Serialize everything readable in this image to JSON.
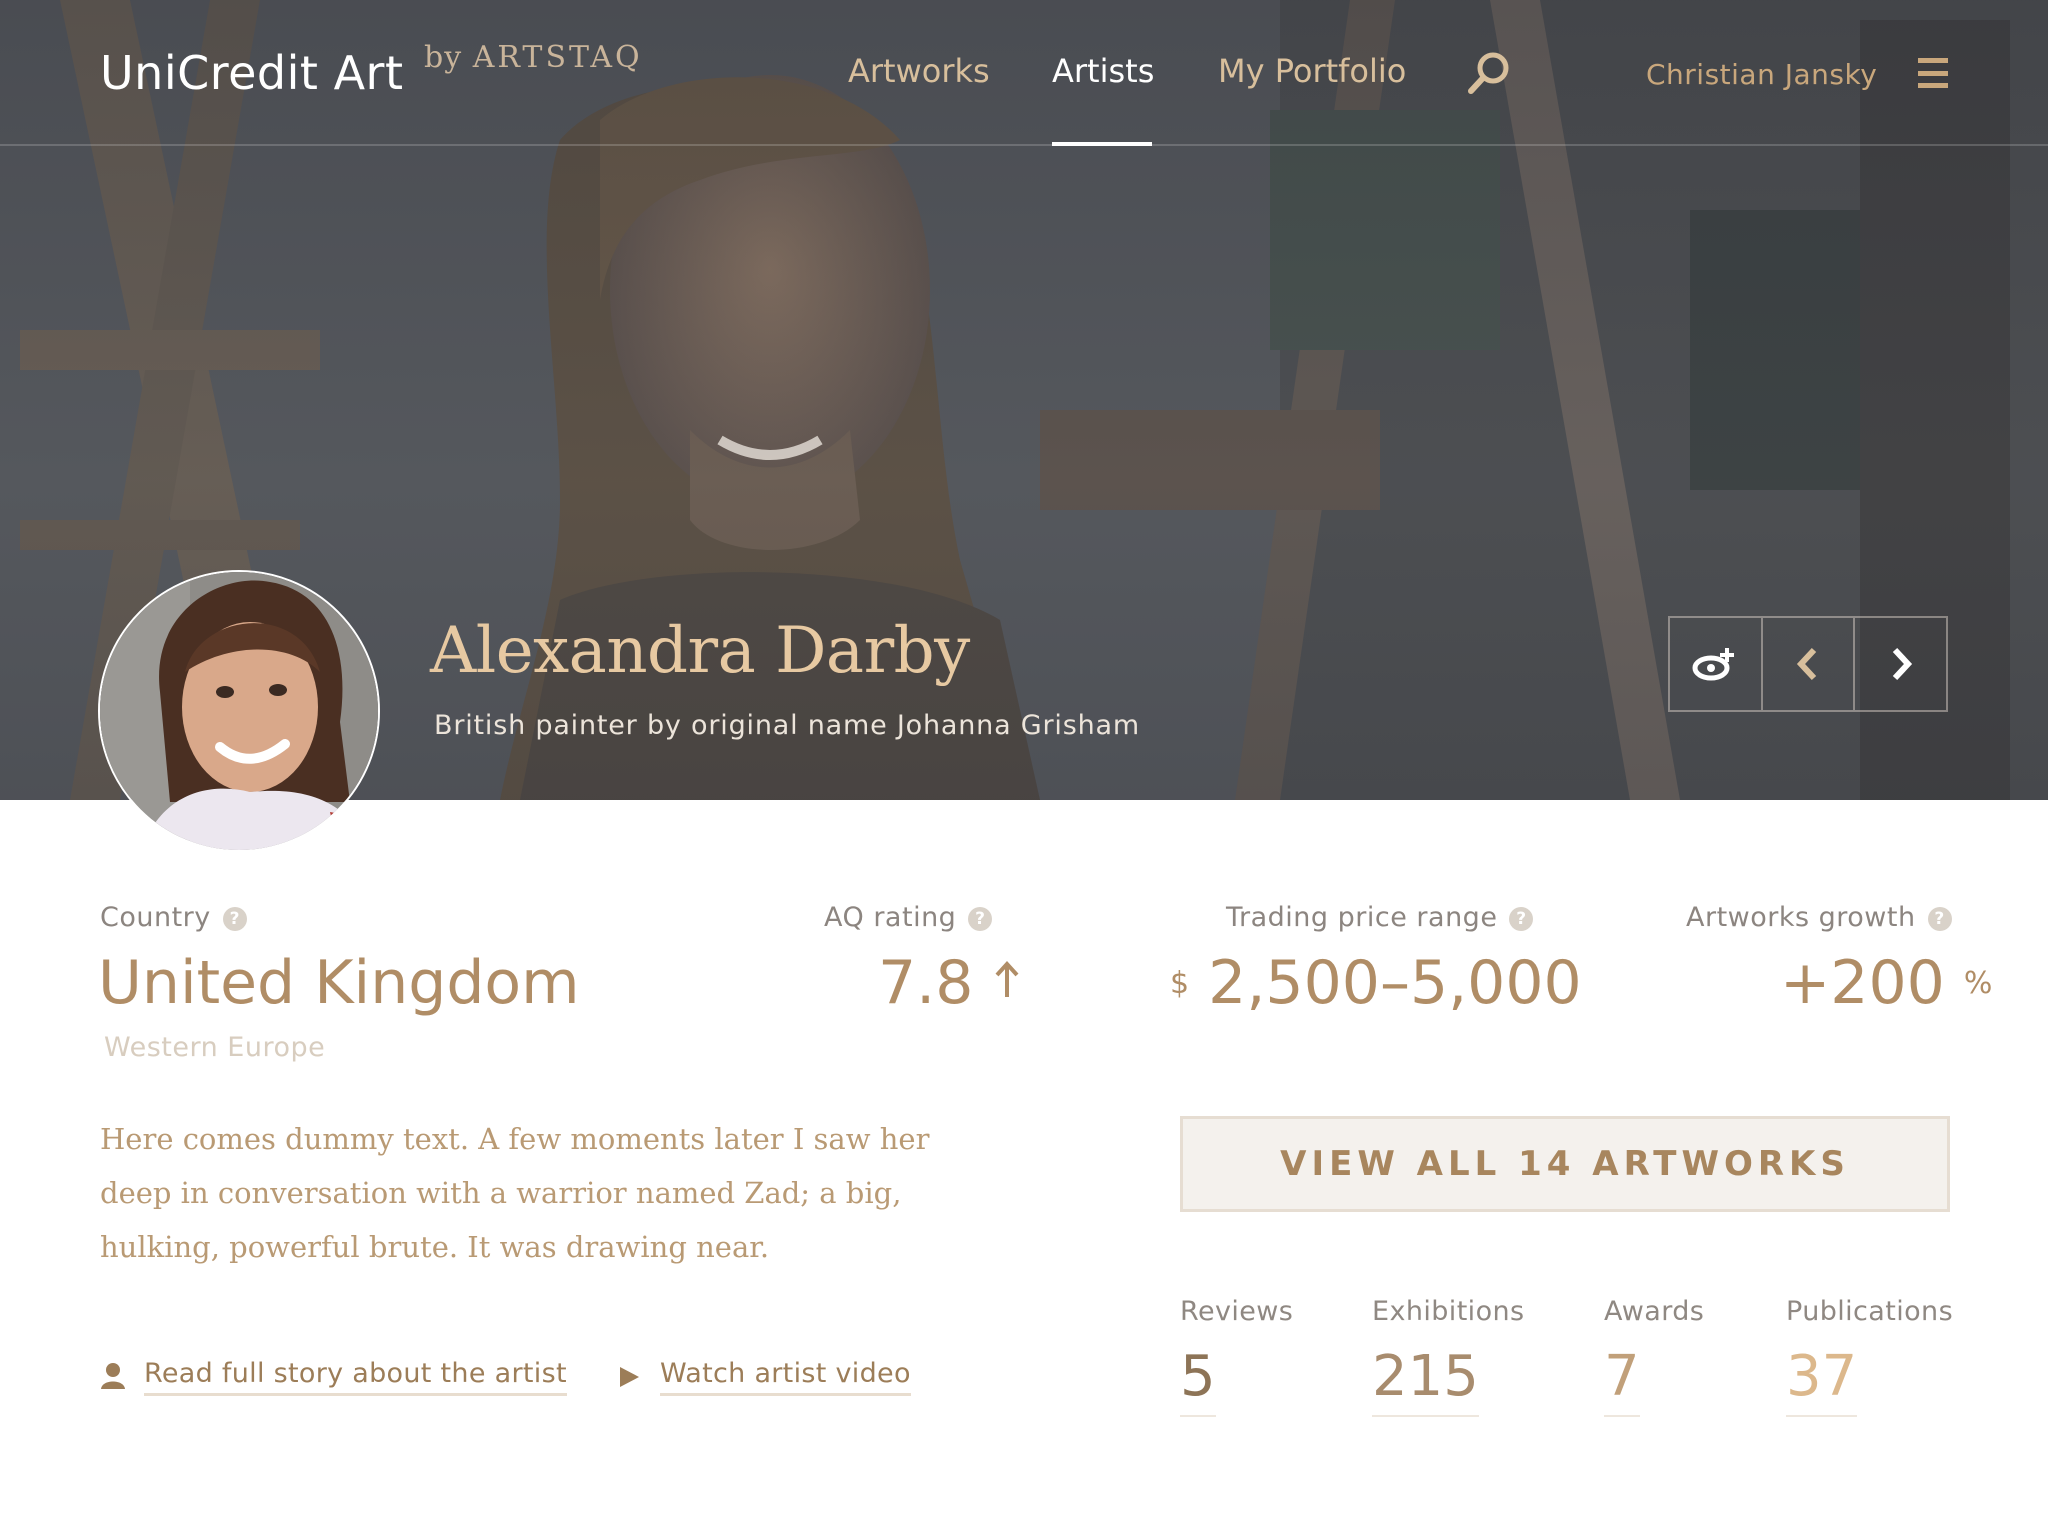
{
  "header": {
    "logo": "UniCredit Art",
    "byline_prefix": "by",
    "byline_brand": "ARTSTAQ",
    "nav": [
      "Artworks",
      "Artists",
      "My Portfolio"
    ],
    "active_nav": "Artists",
    "user_name": "Christian Jansky",
    "icons": {
      "search": "search-icon",
      "menu": "hamburger-menu-icon"
    }
  },
  "hero": {
    "artist_name": "Alexandra Darby",
    "subtitle": "British painter by original name Johanna Grisham",
    "controls": [
      "follow-icon",
      "chevron-left-icon",
      "chevron-right-icon"
    ]
  },
  "stats": {
    "country": {
      "label": "Country",
      "value": "United Kingdom",
      "region": "Western Europe"
    },
    "aq_rating": {
      "label": "AQ rating",
      "value": "7.8",
      "trend": "up-arrow-icon"
    },
    "price_range": {
      "label": "Trading price range",
      "currency": "$",
      "value": "2,500–5,000"
    },
    "growth": {
      "label": "Artworks growth",
      "value": "+200",
      "unit": "%"
    }
  },
  "description": "Here comes dummy text. A few moments later I saw her deep in conversation with a warrior named Zad; a big, hulking, powerful brute. It was drawing near.",
  "links": {
    "story": "Read full story about the artist",
    "video": "Watch artist video"
  },
  "view_all_button": "VIEW ALL 14 ARTWORKS",
  "counts": [
    {
      "label": "Reviews",
      "value": "5",
      "color": "#8d7457"
    },
    {
      "label": "Exhibitions",
      "value": "215",
      "color": "#a88c6e"
    },
    {
      "label": "Awards",
      "value": "7",
      "color": "#c1a07a"
    },
    {
      "label": "Publications",
      "value": "37",
      "color": "#dcb88c"
    }
  ],
  "colors": {
    "accent": "#b08d66",
    "nav_active": "#ffffff",
    "nav": "#d8bf9c"
  }
}
